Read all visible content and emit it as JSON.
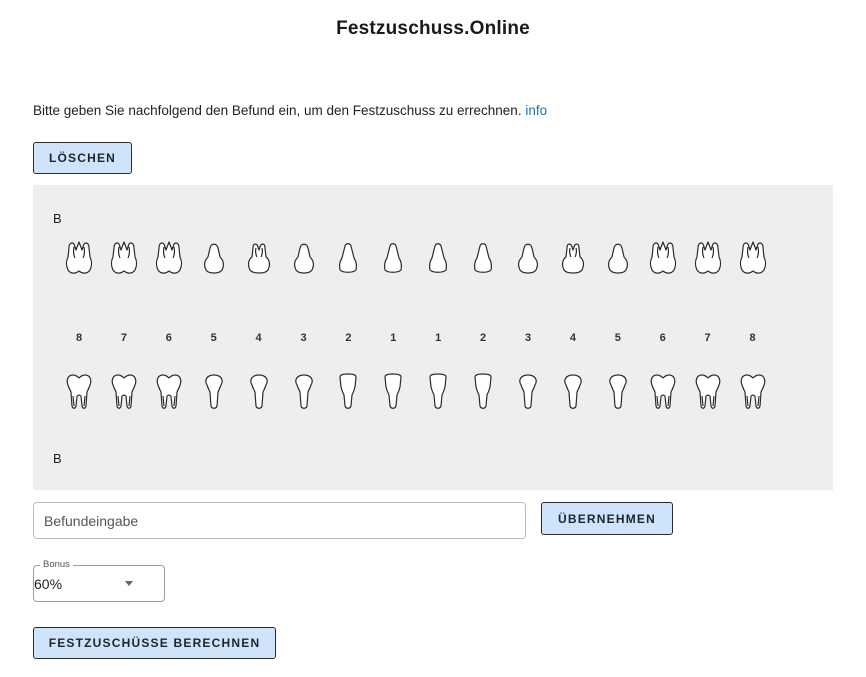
{
  "header": {
    "title": "Festzuschuss.Online"
  },
  "intro": {
    "text": "Bitte geben Sie nachfolgend den Befund ein, um den Festzuschuss zu errechnen.",
    "link": "info"
  },
  "buttons": {
    "clear": "LÖSCHEN",
    "apply": "ÜBERNEHMEN",
    "calculate": "FESTZUSCHÜSSE BERECHNEN"
  },
  "chart": {
    "top_label": "B",
    "bottom_label": "B",
    "upper_types": [
      "molar",
      "molar",
      "molar",
      "premolar",
      "premolar-two",
      "premolar",
      "anterior",
      "anterior",
      "anterior",
      "anterior",
      "premolar",
      "premolar-two",
      "premolar",
      "molar",
      "molar",
      "molar"
    ],
    "lower_types": [
      "molar",
      "molar",
      "molar",
      "premolar",
      "premolar",
      "premolar",
      "anterior",
      "anterior",
      "anterior",
      "anterior",
      "premolar",
      "premolar",
      "premolar",
      "molar",
      "molar",
      "molar"
    ],
    "tooth_numbers": [
      "8",
      "7",
      "6",
      "5",
      "4",
      "3",
      "2",
      "1",
      "1",
      "2",
      "3",
      "4",
      "5",
      "6",
      "7",
      "8"
    ]
  },
  "findings_input": {
    "placeholder": "Befundeingabe",
    "value": ""
  },
  "bonus": {
    "label": "Bonus",
    "value": "60%"
  }
}
